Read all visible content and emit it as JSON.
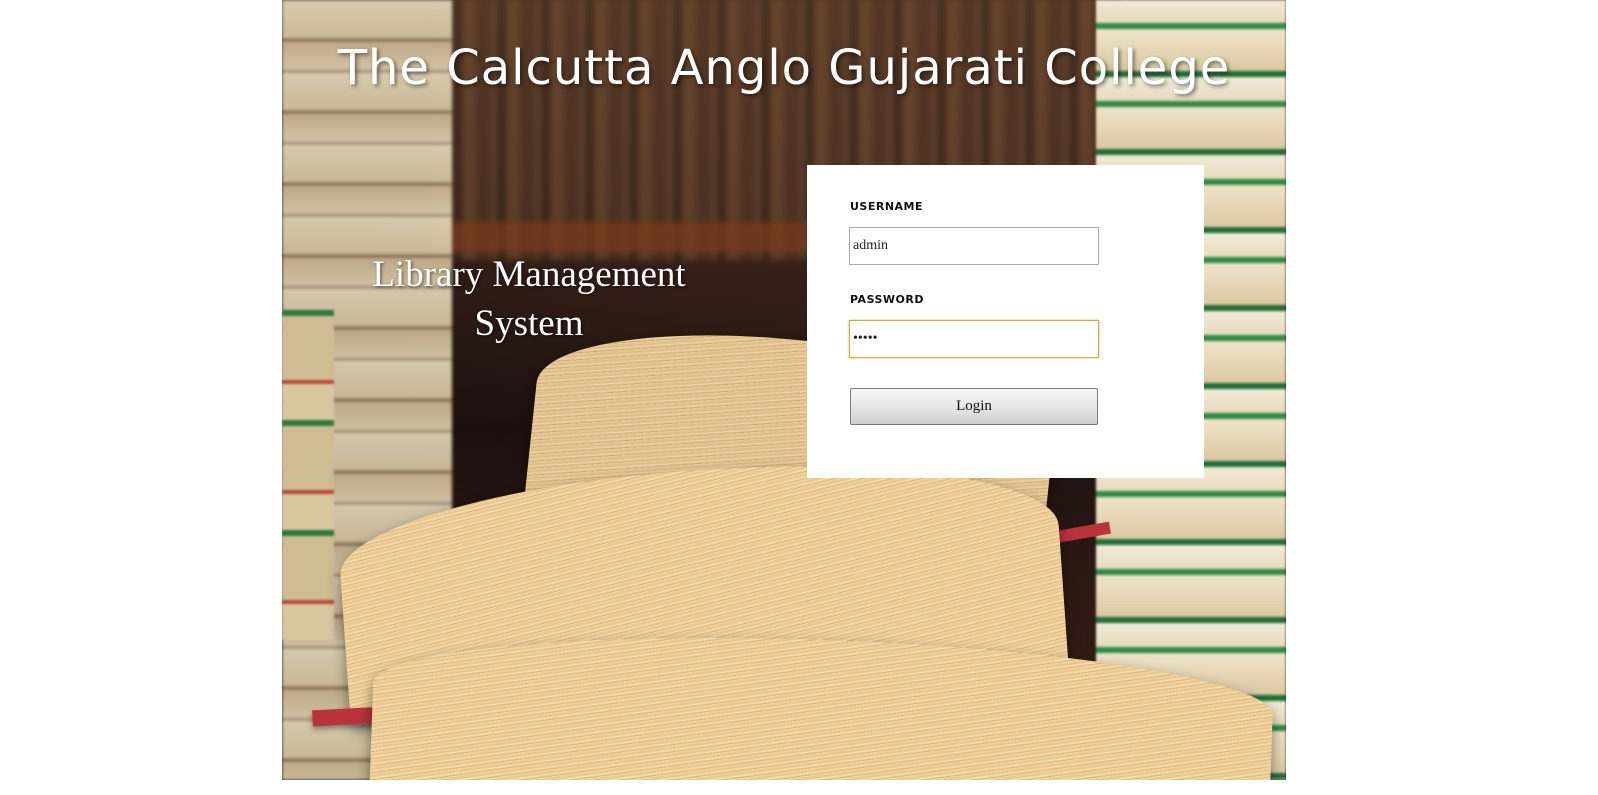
{
  "header": {
    "college_name": "The Calcutta Anglo Gujarati College"
  },
  "hero": {
    "system_title_line1": "Library Management",
    "system_title_line2": "System"
  },
  "login_form": {
    "username_label": "USERNAME",
    "username_value": "admin",
    "password_label": "PASSWORD",
    "password_value": "•••••",
    "login_button_label": "Login"
  },
  "colors": {
    "card_background": "#ffffff",
    "focus_border": "#d9a441",
    "title_text": "#ffffff"
  },
  "background": {
    "image_subject": "stacks of old books and open books on a library shelf"
  }
}
